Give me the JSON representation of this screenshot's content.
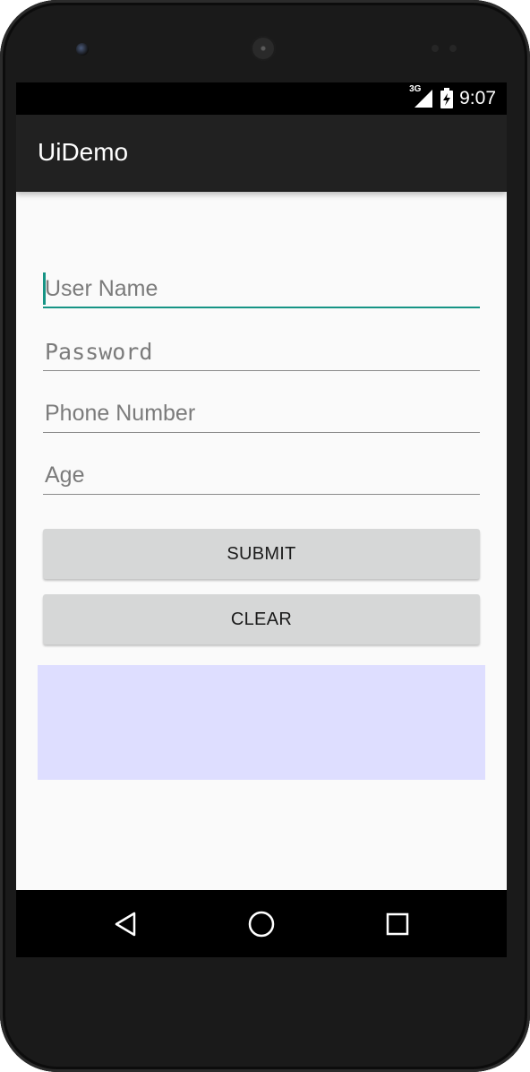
{
  "status_bar": {
    "network_label": "3G",
    "time": "9:07",
    "icons": [
      "signal-3g-icon",
      "battery-charging-icon"
    ]
  },
  "app_bar": {
    "title": "UiDemo"
  },
  "form": {
    "fields": [
      {
        "name": "username",
        "placeholder": "User Name",
        "value": "",
        "focused": true
      },
      {
        "name": "password",
        "placeholder": "Password",
        "value": "",
        "focused": false
      },
      {
        "name": "phone",
        "placeholder": "Phone Number",
        "value": "",
        "focused": false
      },
      {
        "name": "age",
        "placeholder": "Age",
        "value": "",
        "focused": false
      }
    ],
    "submit_label": "SUBMIT",
    "clear_label": "CLEAR"
  },
  "output_panel": {
    "text": "",
    "color": "#dedeff"
  },
  "nav_bar": {
    "icons": [
      "back-icon",
      "home-icon",
      "recents-icon"
    ]
  },
  "colors": {
    "accent": "#169485",
    "app_bar": "#212121",
    "button": "#d6d7d7"
  }
}
